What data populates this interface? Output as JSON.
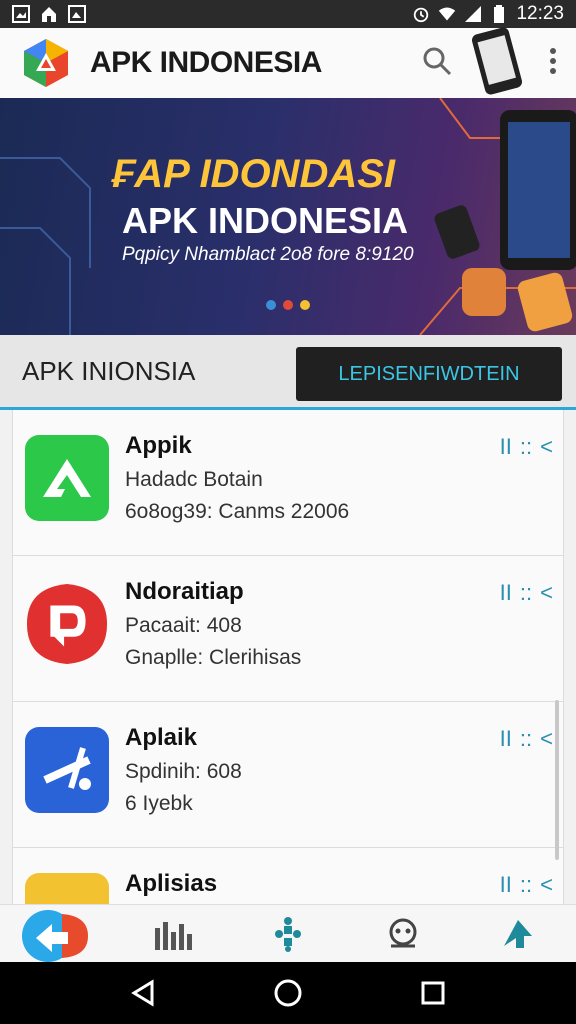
{
  "status": {
    "time": "12:23"
  },
  "app_bar": {
    "title": "APK INDONESIA"
  },
  "banner": {
    "line1": "₣AP IDONDASI",
    "line2": "APK INDONESIA",
    "line3": "Pqpicy Nhamblact 2o8 fore 8:9120",
    "dots": [
      "#3a8fd8",
      "#e04a3a",
      "#f2c230"
    ]
  },
  "section": {
    "title": "APK INIONSIA",
    "button_label": "LEPISENFIWDTEIN"
  },
  "apps": [
    {
      "title": "Appik",
      "subtitle": "Hadadc Botain",
      "meta": "6o8og39: Canms 22006",
      "icon": "green-arrow-icon"
    },
    {
      "title": "Ndoraitiap",
      "subtitle": "Pacaait: 408",
      "meta": "Gnaplle: Clerihisas",
      "icon": "red-d-icon"
    },
    {
      "title": "Aplaik",
      "subtitle": "Spdinih: 608",
      "meta": "6 Iyebk",
      "icon": "blue-slash-icon"
    },
    {
      "title": "Aplisias",
      "subtitle": "",
      "meta": "",
      "icon": "yellow-app-icon"
    }
  ],
  "row_actions": {
    "bars": "II",
    "colons": "::",
    "chevron": "<"
  },
  "colors": {
    "accent": "#2aa8d8",
    "button_bg": "#202020",
    "button_text": "#3bc6e6"
  }
}
